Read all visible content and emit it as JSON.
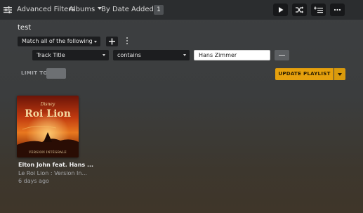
{
  "toolbar": {
    "title": "Advanced Filters",
    "type_dropdown": "Albums",
    "sort_dropdown": "By Date Added",
    "count": "1",
    "play_icon": "play-icon",
    "shuffle_icon": "shuffle-icon",
    "add_to_queue_icon": "add-to-queue-icon",
    "more_icon": "more-icon"
  },
  "playlist": {
    "name": "test"
  },
  "filter": {
    "match_mode": "Match all of the following",
    "rule": {
      "field": "Track Title",
      "operator": "contains",
      "value": "Hans Zimmer"
    }
  },
  "limit": {
    "label": "LIMIT TO",
    "enabled": false
  },
  "update_button": {
    "label": "UPDATE PLAYLIST"
  },
  "results": [
    {
      "artwork": {
        "disney_mark": "Disney",
        "title": "Roi Lion",
        "subtitle": "VERSION INTÉGRALE"
      },
      "title": "Elton John feat. Hans ...",
      "subtitle": "Le Roi Lion : Version In...",
      "added": "6 days ago"
    }
  ],
  "colors": {
    "accent": "#e5a00d",
    "topbar": "#2b2d2f",
    "control": "#1c1d1f"
  }
}
